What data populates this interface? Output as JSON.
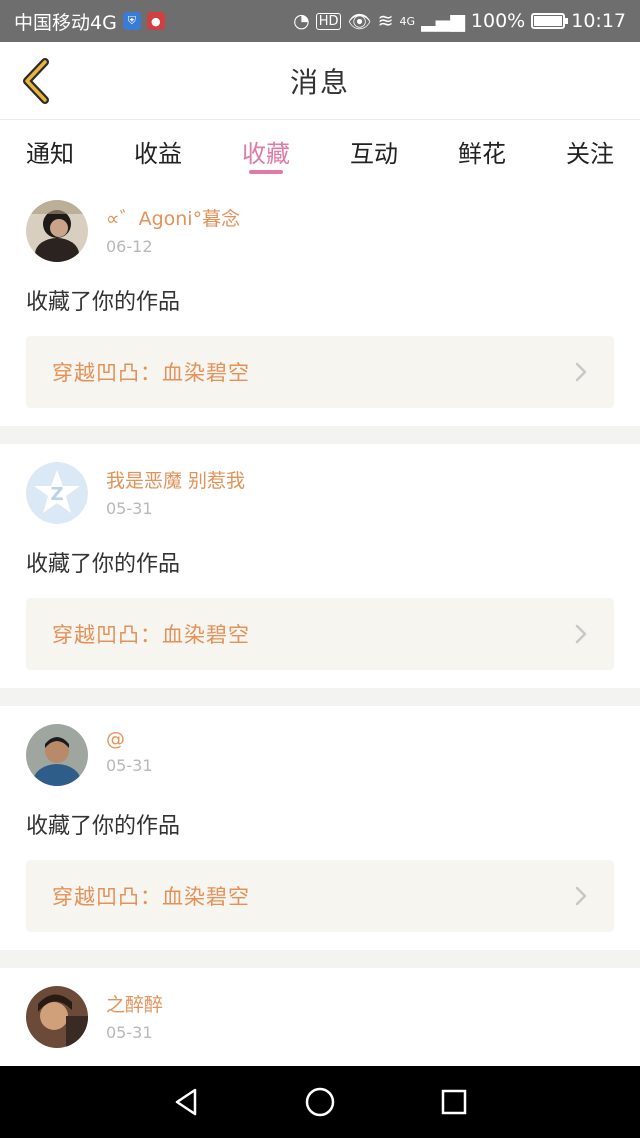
{
  "status_bar": {
    "carrier": "中国移动4G",
    "battery": "100%",
    "time": "10:17",
    "hd": "HD",
    "net": "4G"
  },
  "header": {
    "title": "消息"
  },
  "tabs": [
    {
      "label": "通知",
      "active": false
    },
    {
      "label": "收益",
      "active": false
    },
    {
      "label": "收藏",
      "active": true
    },
    {
      "label": "互动",
      "active": false
    },
    {
      "label": "鲜花",
      "active": false
    },
    {
      "label": "关注",
      "active": false
    }
  ],
  "items": [
    {
      "user": "∝゛Agoni°暮念",
      "date": "06-12",
      "action": "收藏了你的作品",
      "work": "穿越凹凸：血染碧空"
    },
    {
      "user": "我是恶魔 别惹我",
      "date": "05-31",
      "action": "收藏了你的作品",
      "work": "穿越凹凸：血染碧空"
    },
    {
      "user": "@",
      "date": "05-31",
      "action": "收藏了你的作品",
      "work": "穿越凹凸：血染碧空"
    },
    {
      "user": "之醉醉",
      "date": "05-31",
      "action": "",
      "work": ""
    }
  ],
  "colors": {
    "accent_pink": "#e07aa6",
    "accent_orange": "#e4925a",
    "status_bar_bg": "#6e6e6e"
  }
}
